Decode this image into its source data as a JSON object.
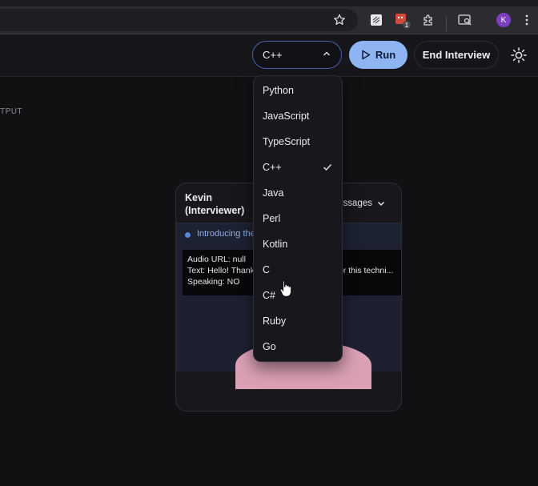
{
  "browser": {
    "profile_initial": "K",
    "extension_badge": "1"
  },
  "toolbar": {
    "language": "C++",
    "run_label": "Run",
    "end_label": "End Interview"
  },
  "output_label": "TPUT",
  "interviewer": {
    "name": "Kevin",
    "role": "(Interviewer)",
    "messages_label": "essages",
    "status": "Introducing the",
    "debug": {
      "line1": "Audio URL: null",
      "line2": "Text: Hello! Thank",
      "line2_tail": "or this techni...",
      "line3": "Speaking: NO"
    }
  },
  "language_menu": {
    "selected": "C++",
    "options": [
      "Python",
      "JavaScript",
      "TypeScript",
      "C++",
      "Java",
      "Perl",
      "Kotlin",
      "C",
      "C#",
      "Ruby",
      "Go"
    ]
  },
  "colors": {
    "accent": "#8fb4f2",
    "selected_border": "#4a5fb0",
    "profile": "#7b3fbf",
    "extension_red": "#d04a3a"
  }
}
